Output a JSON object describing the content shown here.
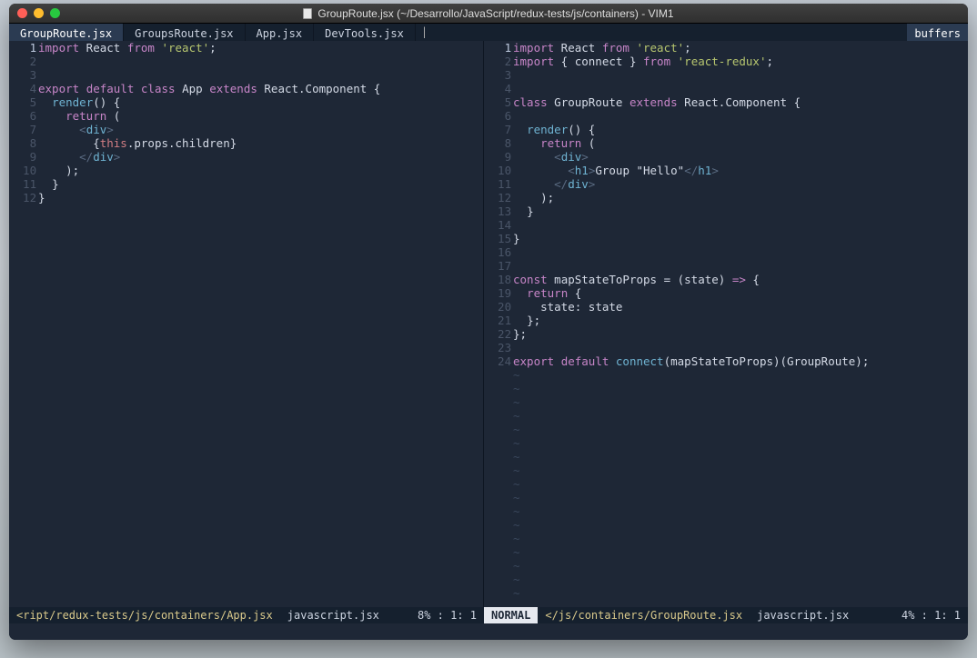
{
  "window": {
    "title": "GroupRoute.jsx (~/Desarrollo/JavaScript/redux-tests/js/containers) - VIM1"
  },
  "tabs": {
    "t0": "GroupRoute.jsx",
    "t1": "GroupsRoute.jsx",
    "t2": "App.jsx",
    "t3": "DevTools.jsx",
    "buffers": "buffers"
  },
  "left": {
    "gutter": "   1\n   2\n   3\n   4\n   5\n   6\n   7\n   8\n   9\n  10\n  11\n  12",
    "status_path": "<ript/redux-tests/js/containers/App.jsx",
    "status_ft": "javascript.jsx",
    "status_pos": "8% :   1:  1",
    "code": {
      "l1_import": "import",
      "l1_from": "from",
      "l1_react": "'react'",
      "l4_export": "export",
      "l4_default": "default",
      "l4_class": "class",
      "l4_app": " App ",
      "l4_ext": "extends",
      "l4_rc": " React.Component {",
      "l5_render": "render",
      "l5_rest": "() {",
      "l6_return": "return",
      "l6_rest": " (",
      "l7_open": "<",
      "l7_div": "div",
      "l7_close": ">",
      "l8_this": "this",
      "l8_rest": ".props.children}",
      "l9_open": "</",
      "l9_div": "div",
      "l9_close": ">",
      "l10": ");",
      "l11": "}",
      "l12": "}"
    }
  },
  "right": {
    "gutter": "   1\n   2\n   3\n   4\n   5\n   6\n   7\n   8\n   9\n  10\n  11\n  12\n  13\n  14\n  15\n  16\n  17\n  18\n  19\n  20\n  21\n  22\n  23\n  24",
    "mode": "NORMAL",
    "status_path": "</js/containers/GroupRoute.jsx",
    "status_ft": "javascript.jsx",
    "status_pos": "4% :   1:  1",
    "code": {
      "l1_import": "import",
      "l1_from": "from",
      "l1_react": "'react'",
      "l2_import": "import",
      "l2_conn": " { connect } ",
      "l2_from": "from",
      "l2_rr": "'react-redux'",
      "l5_class": "class",
      "l5_name": " GroupRoute ",
      "l5_ext": "extends",
      "l5_rc": " React.Component {",
      "l7_render": "render",
      "l7_rest": "() {",
      "l8_return": "return",
      "l8_rest": " (",
      "l9_open": "<",
      "l9_div": "div",
      "l9_close": ">",
      "l10_open": "<",
      "l10_h1": "h1",
      "l10_gt": ">",
      "l10_txt": "Group \"Hello\"",
      "l10_open2": "</",
      "l10_h12": "h1",
      "l10_gt2": ">",
      "l11_open": "</",
      "l11_div": "div",
      "l11_close": ">",
      "l12": ");",
      "l13": "}",
      "l15": "}",
      "l18_const": "const",
      "l18_m": " mapStateToProps ",
      "l18_eq": "= (state) ",
      "l18_ar": "=>",
      "l18_brace": " {",
      "l19_return": "return",
      "l19_rest": " {",
      "l20": "state: state",
      "l21": "};",
      "l22": "};",
      "l24_export": "export",
      "l24_default": "default",
      "l24_conn": "connect",
      "l24_rest": "(mapStateToProps)(GroupRoute);"
    }
  }
}
